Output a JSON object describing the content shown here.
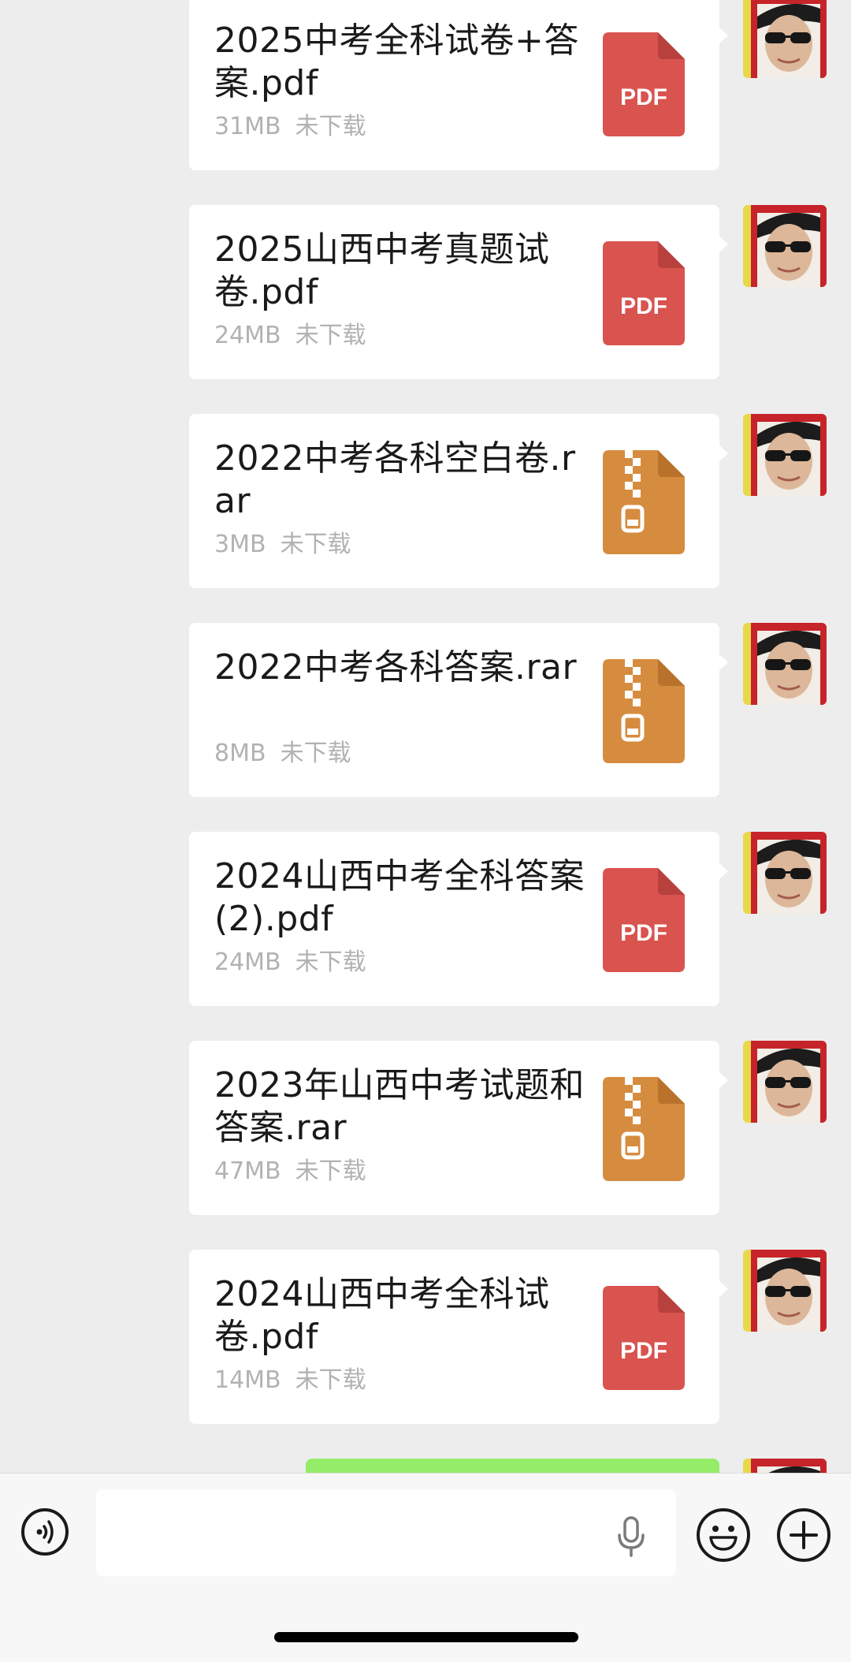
{
  "files": [
    {
      "name": "2025中考全科试卷+答案.pdf",
      "size": "31MB",
      "status": "未下载",
      "type": "pdf",
      "icon_label": "PDF"
    },
    {
      "name": "2025山西中考真题试卷.pdf",
      "size": "24MB",
      "status": "未下载",
      "type": "pdf",
      "icon_label": "PDF"
    },
    {
      "name": "2022中考各科空白卷.rar",
      "size": "3MB",
      "status": "未下载",
      "type": "rar",
      "icon_label": ""
    },
    {
      "name": "2022中考各科答案.rar",
      "size": "8MB",
      "status": "未下载",
      "type": "rar",
      "icon_label": ""
    },
    {
      "name": "2024山西中考全科答案 (2).pdf",
      "size": "24MB",
      "status": "未下载",
      "type": "pdf",
      "icon_label": "PDF"
    },
    {
      "name": "2023年山西中考试题和答案.rar",
      "size": "47MB",
      "status": "未下载",
      "type": "rar",
      "icon_label": ""
    },
    {
      "name": "2024山西中考全科试卷.pdf",
      "size": "14MB",
      "status": "未下载",
      "type": "pdf",
      "icon_label": "PDF"
    }
  ],
  "input_bar": {
    "voice_icon": "voice-toggle-icon",
    "mic_icon": "microphone-icon",
    "emoji_icon": "emoji-icon",
    "plus_icon": "plus-icon",
    "text_value": ""
  },
  "colors": {
    "pdf": "#d9534f",
    "rar": "#d68c3e",
    "background": "#ededed",
    "bubble": "#ffffff",
    "sent_bubble": "#95ec69"
  }
}
